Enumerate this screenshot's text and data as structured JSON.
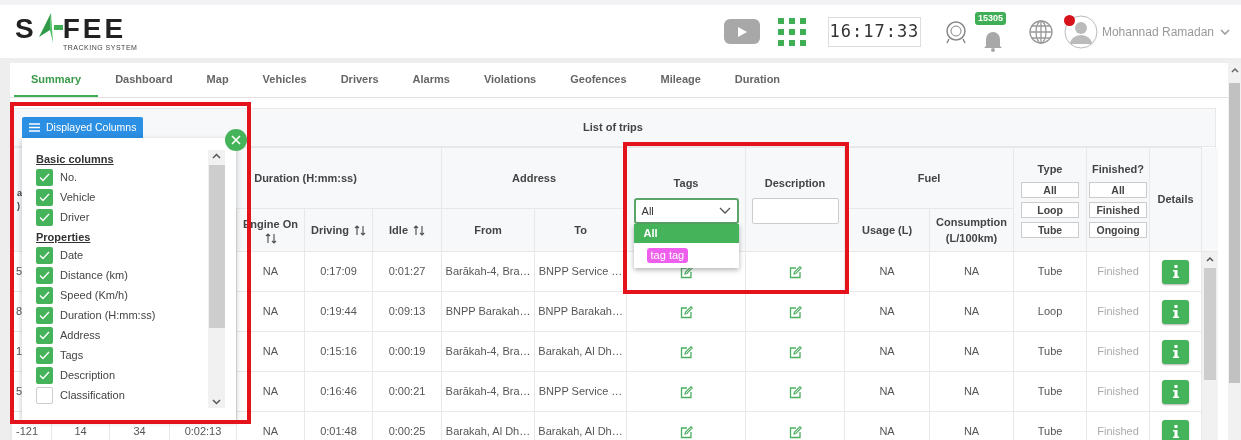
{
  "header": {
    "logo": {
      "letters_before": "S",
      "letters_after": "FEE",
      "tagline": "TRACKING SYSTEM"
    },
    "clock": "16:17:33",
    "notification_count": "15305",
    "user_name": "Mohannad Ramadan"
  },
  "nav": {
    "tabs": [
      {
        "label": "Summary",
        "selected": true
      },
      {
        "label": "Dashboard",
        "selected": false
      },
      {
        "label": "Map",
        "selected": false
      },
      {
        "label": "Vehicles",
        "selected": false
      },
      {
        "label": "Drivers",
        "selected": false
      },
      {
        "label": "Alarms",
        "selected": false
      },
      {
        "label": "Violations",
        "selected": false
      },
      {
        "label": "Geofences",
        "selected": false
      },
      {
        "label": "Mileage",
        "selected": false
      },
      {
        "label": "Duration",
        "selected": false
      }
    ]
  },
  "column_picker": {
    "button": "Displayed Columns",
    "sections": [
      {
        "title": "Basic columns",
        "items": [
          {
            "label": "No.",
            "checked": true
          },
          {
            "label": "Vehicle",
            "checked": true
          },
          {
            "label": "Driver",
            "checked": true
          }
        ]
      },
      {
        "title": "Properties",
        "items": [
          {
            "label": "Date",
            "checked": true
          },
          {
            "label": "Distance (km)",
            "checked": true
          },
          {
            "label": "Speed (Km/h)",
            "checked": true
          },
          {
            "label": "Duration (H:mm:ss)",
            "checked": true
          },
          {
            "label": "Address",
            "checked": true
          },
          {
            "label": "Tags",
            "checked": true
          },
          {
            "label": "Description",
            "checked": true
          },
          {
            "label": "Classification",
            "checked": false
          }
        ]
      }
    ]
  },
  "table": {
    "title": "List of trips",
    "header": [
      {
        "kind": "text",
        "label": "a)"
      },
      {
        "kind": "text"
      },
      {
        "kind": "text"
      },
      {
        "kind": "group",
        "label": "Duration (H:mm:ss)",
        "columns": [
          {
            "kind": "text"
          },
          {
            "kind": "text",
            "label": "Engine On",
            "sortable": true
          },
          {
            "kind": "text",
            "label": "Driving",
            "sortable": true
          },
          {
            "kind": "text",
            "label": "Idle",
            "sortable": true
          }
        ]
      },
      {
        "kind": "group",
        "label": "Address",
        "columns": [
          {
            "kind": "text",
            "label": "From"
          },
          {
            "kind": "text",
            "label": "To"
          }
        ]
      },
      {
        "kind": "edit",
        "label": "Tags",
        "filter": {
          "kind": "select",
          "value": "All",
          "open": true,
          "options": [
            {
              "label": "All",
              "selected": true
            },
            {
              "label": "tag tag",
              "selected": false,
              "color": "#ee5fee"
            }
          ]
        }
      },
      {
        "kind": "edit",
        "label": "Description",
        "filter": {
          "kind": "input"
        }
      },
      {
        "kind": "group",
        "label": "Fuel",
        "columns": [
          {
            "kind": "text",
            "label": "Usage (L)"
          },
          {
            "kind": "text",
            "label": "Consumption (L/100km)"
          }
        ]
      },
      {
        "kind": "text",
        "label": "Type",
        "filter": {
          "kind": "buttons",
          "options": [
            "All",
            "Loop",
            "Tube"
          ]
        }
      },
      {
        "kind": "text",
        "label": "Finished?",
        "muted": true,
        "filter": {
          "kind": "buttons",
          "options": [
            "All",
            "Finished",
            "Ongoing"
          ]
        }
      },
      {
        "kind": "button",
        "label": "Details"
      }
    ],
    "rows": [
      {
        "cells": [
          "5",
          null,
          null,
          null,
          "NA",
          "0:17:09",
          "0:01:27",
          "Barākah-4, Bra…",
          "BNPP Service …",
          null,
          null,
          "NA",
          "NA",
          "Tube",
          "Finished",
          null
        ]
      },
      {
        "cells": [
          "8",
          null,
          null,
          null,
          "NA",
          "0:19:44",
          "0:09:13",
          "BNPP Barakah…",
          "BNPP Barakah…",
          null,
          null,
          "NA",
          "NA",
          "Loop",
          "Finished",
          null
        ]
      },
      {
        "cells": [
          "1",
          null,
          null,
          null,
          "NA",
          "0:15:16",
          "0:00:19",
          "Barākah-4, Bra…",
          "Barakah, Al Dh…",
          null,
          null,
          "NA",
          "NA",
          "Tube",
          "Finished",
          null
        ]
      },
      {
        "cells": [
          "5",
          null,
          null,
          null,
          "NA",
          "0:16:46",
          "0:00:21",
          "Barākah-4, Bra…",
          "BNPP Service …",
          null,
          null,
          "NA",
          "NA",
          "Tube",
          "Finished",
          null
        ]
      },
      {
        "cells": [
          "-121",
          "14",
          "34",
          "0:02:13",
          "NA",
          "0:01:48",
          "0:00:25",
          "Barakah, Al Dh…",
          "Barakah, Al Dh…",
          null,
          null,
          "NA",
          "NA",
          "Tube",
          "Finished",
          null
        ]
      }
    ]
  }
}
